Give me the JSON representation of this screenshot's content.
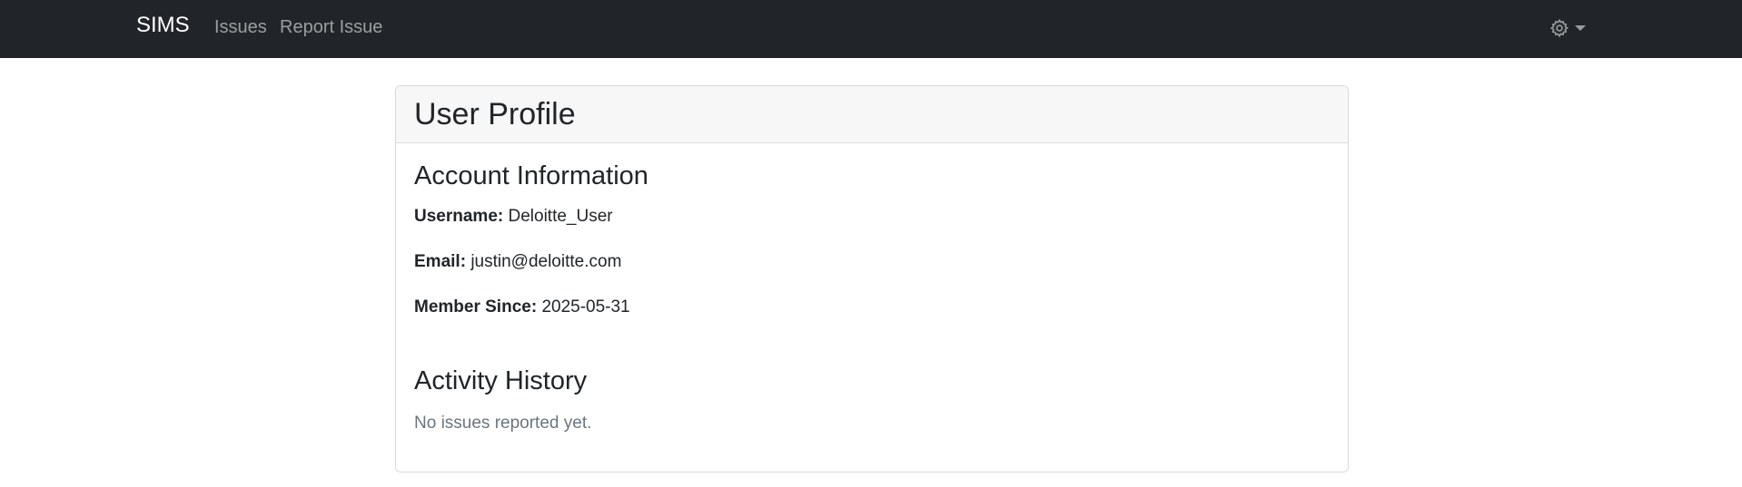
{
  "navbar": {
    "brand": "SIMS",
    "links": [
      {
        "label": "Issues"
      },
      {
        "label": "Report Issue"
      }
    ],
    "settings_icon": "gear-icon",
    "bg_color": "#212529"
  },
  "card": {
    "title": "User Profile",
    "account": {
      "heading": "Account Information",
      "username_label": "Username:",
      "username_value": "Deloitte_User",
      "email_label": "Email:",
      "email_value": "justin@deloitte.com",
      "member_since_label": "Member Since:",
      "member_since_value": "2025-05-31"
    },
    "activity": {
      "heading": "Activity History",
      "empty_message": "No issues reported yet."
    }
  }
}
